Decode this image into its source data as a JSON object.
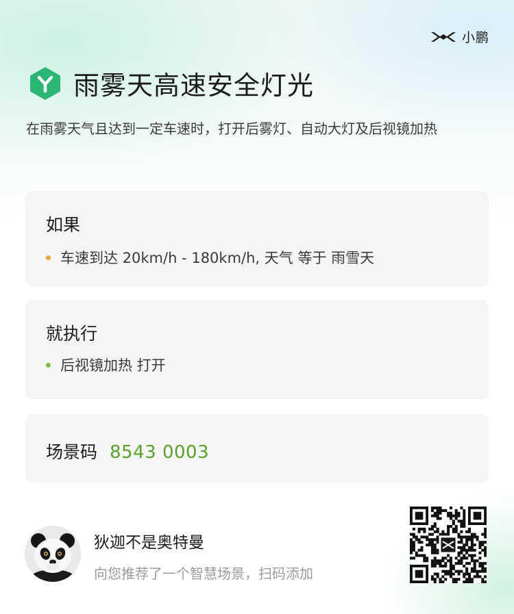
{
  "brand": {
    "name": "小鹏",
    "logo_icon": "xpeng-logo-icon"
  },
  "scene": {
    "icon": "xpeng-hexagon-icon",
    "title": "雨雾天高速安全灯光",
    "description": "在雨雾天气且达到一定车速时，打开后雾灯、自动大灯及后视镜加热"
  },
  "conditions": {
    "title": "如果",
    "items": [
      {
        "text": "车速到达 20km/h - 180km/h, 天气 等于 雨雪天",
        "dot_color": "#f0a23a"
      }
    ]
  },
  "actions": {
    "title": "就执行",
    "items": [
      {
        "text": "后视镜加热 打开",
        "dot_color": "#7cbf4a"
      }
    ]
  },
  "scene_code": {
    "label": "场景码",
    "value": "8543 0003",
    "color": "#5aa02c"
  },
  "sharer": {
    "avatar_icon": "panda-avatar",
    "name": "狄迦不是奥特曼",
    "subtitle": "向您推荐了一个智慧场景，扫码添加"
  },
  "qr": {
    "icon": "qr-code",
    "center_icon": "xpeng-logo-icon"
  },
  "colors": {
    "accent_green": "#5aa02c",
    "hex_icon": "#2bb673"
  }
}
